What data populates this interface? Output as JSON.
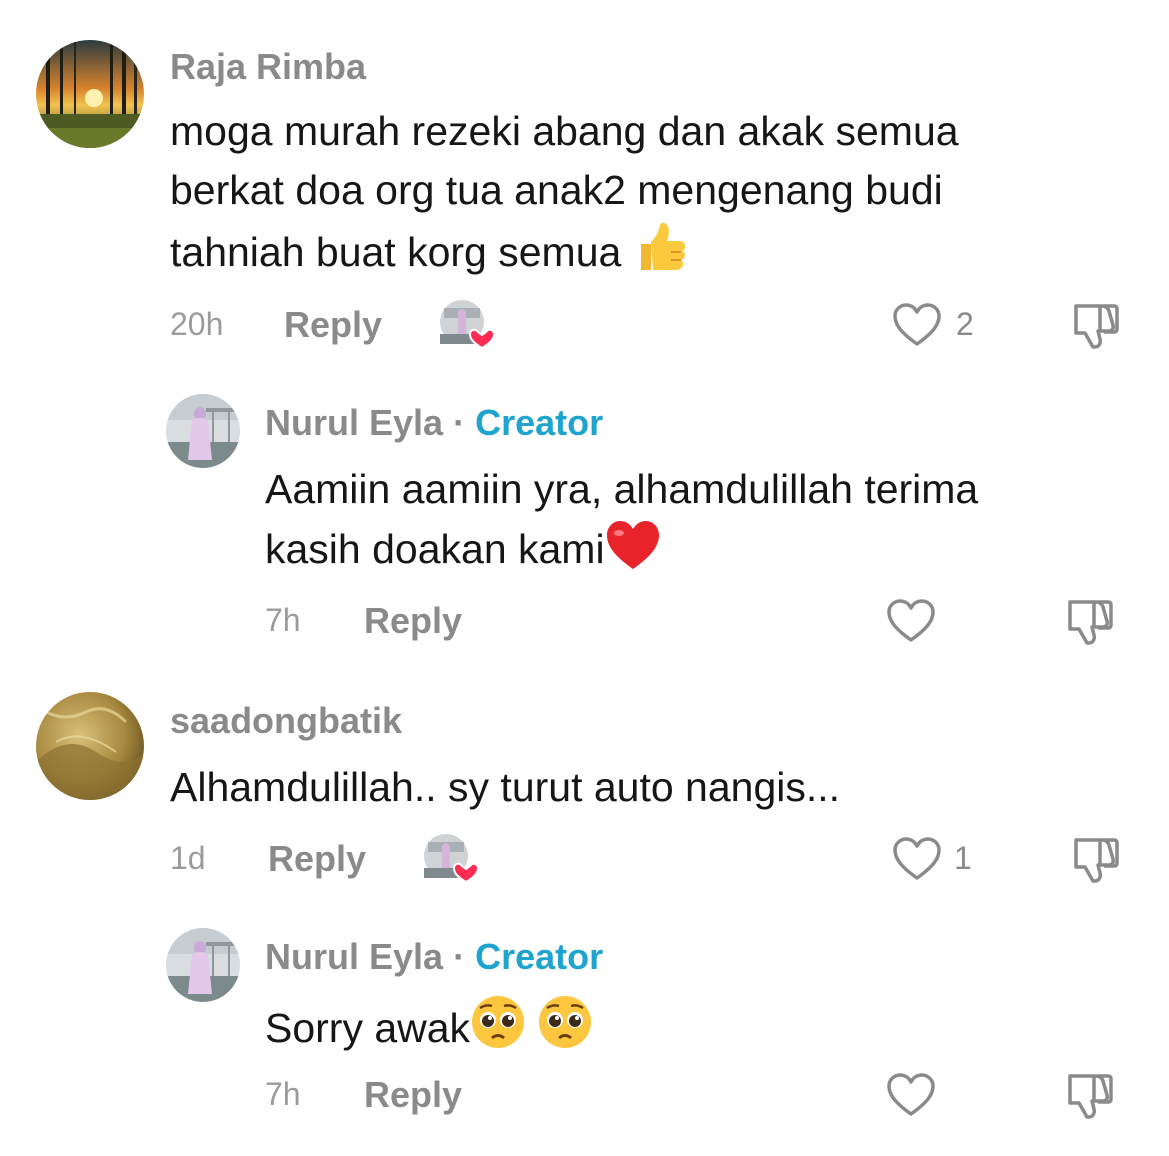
{
  "comments": [
    {
      "username": "Raja Rimba",
      "text_lines": [
        "moga murah rezeki abang dan akak semua",
        "berkat doa org tua anak2 mengenang budi",
        "tahniah buat korg semua"
      ],
      "time": "20h",
      "reply_label": "Reply",
      "like_count": "2",
      "creator_liked": true,
      "avatar_icon": "forest-sunset-avatar"
    },
    {
      "username": "Nurul Eyla",
      "badge": "Creator",
      "separator": "·",
      "text_lines": [
        "Aamiin aamiin yra, alhamdulillah terima",
        "kasih doakan kami"
      ],
      "time": "7h",
      "reply_label": "Reply",
      "like_count": "",
      "avatar_icon": "woman-hijab-avatar"
    },
    {
      "username": "saadongbatik",
      "text_lines": [
        "Alhamdulillah.. sy turut auto nangis..."
      ],
      "time": "1d",
      "reply_label": "Reply",
      "like_count": "1",
      "creator_liked": true,
      "avatar_icon": "gold-fabric-avatar"
    },
    {
      "username": "Nurul Eyla",
      "badge": "Creator",
      "separator": "·",
      "text_lines": [
        "Sorry awak"
      ],
      "time": "7h",
      "reply_label": "Reply",
      "like_count": "",
      "avatar_icon": "woman-hijab-avatar"
    }
  ],
  "colors": {
    "creator_badge": "#1fa4cf",
    "username": "#8a8a8a",
    "liked_heart": "#fe2c55",
    "text": "#161616"
  }
}
